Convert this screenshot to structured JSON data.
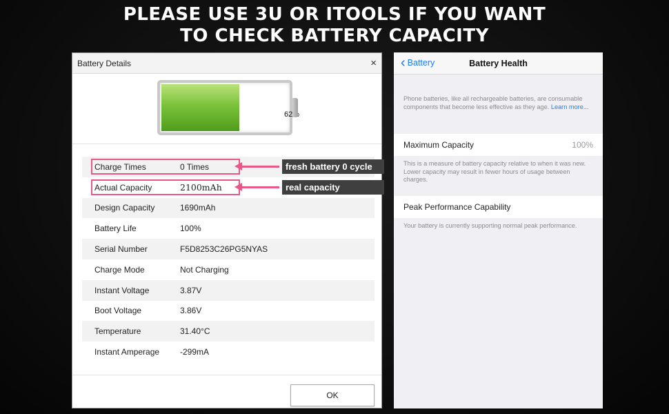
{
  "headline": {
    "line1": "PLEASE USE 3U OR ITOOLS IF YOU WANT",
    "line2": "TO CHECK BATTERY CAPACITY"
  },
  "dialog": {
    "title": "Battery Details",
    "close_icon": "×",
    "battery_percent_label": "62%",
    "battery_level": 0.62,
    "rows": [
      {
        "key": "Charge Times",
        "value": "0 Times"
      },
      {
        "key": "Actual Capacity",
        "value": "2100mAh"
      },
      {
        "key": "Design Capacity",
        "value": "1690mAh"
      },
      {
        "key": "Battery Life",
        "value": "100%"
      },
      {
        "key": "Serial Number",
        "value": "F5D8253C26PG5NYAS"
      },
      {
        "key": "Charge Mode",
        "value": "Not Charging"
      },
      {
        "key": "Instant Voltage",
        "value": "3.87V"
      },
      {
        "key": "Boot Voltage",
        "value": "3.86V"
      },
      {
        "key": "Temperature",
        "value": "31.40°C"
      },
      {
        "key": "Instant Amperage",
        "value": "-299mA"
      }
    ],
    "annotations": {
      "charge_times": "fresh battery 0 cycle",
      "actual_capacity": "real capacity"
    },
    "ok_label": "OK",
    "highlight_color": "#e6588a"
  },
  "ios": {
    "back_label": "Battery",
    "title": "Battery Health",
    "intro_text": "Phone batteries, like all rechargeable batteries, are consumable components that become less effective as they age.",
    "learn_more": "Learn more...",
    "max_capacity_label": "Maximum Capacity",
    "max_capacity_value": "100%",
    "max_capacity_note": "This is a measure of battery capacity relative to when it was new. Lower capacity may result in fewer hours of usage between charges.",
    "peak_label": "Peak Performance Capability",
    "peak_note": "Your battery is currently supporting normal peak performance.",
    "accent_color": "#1a7cf5"
  }
}
